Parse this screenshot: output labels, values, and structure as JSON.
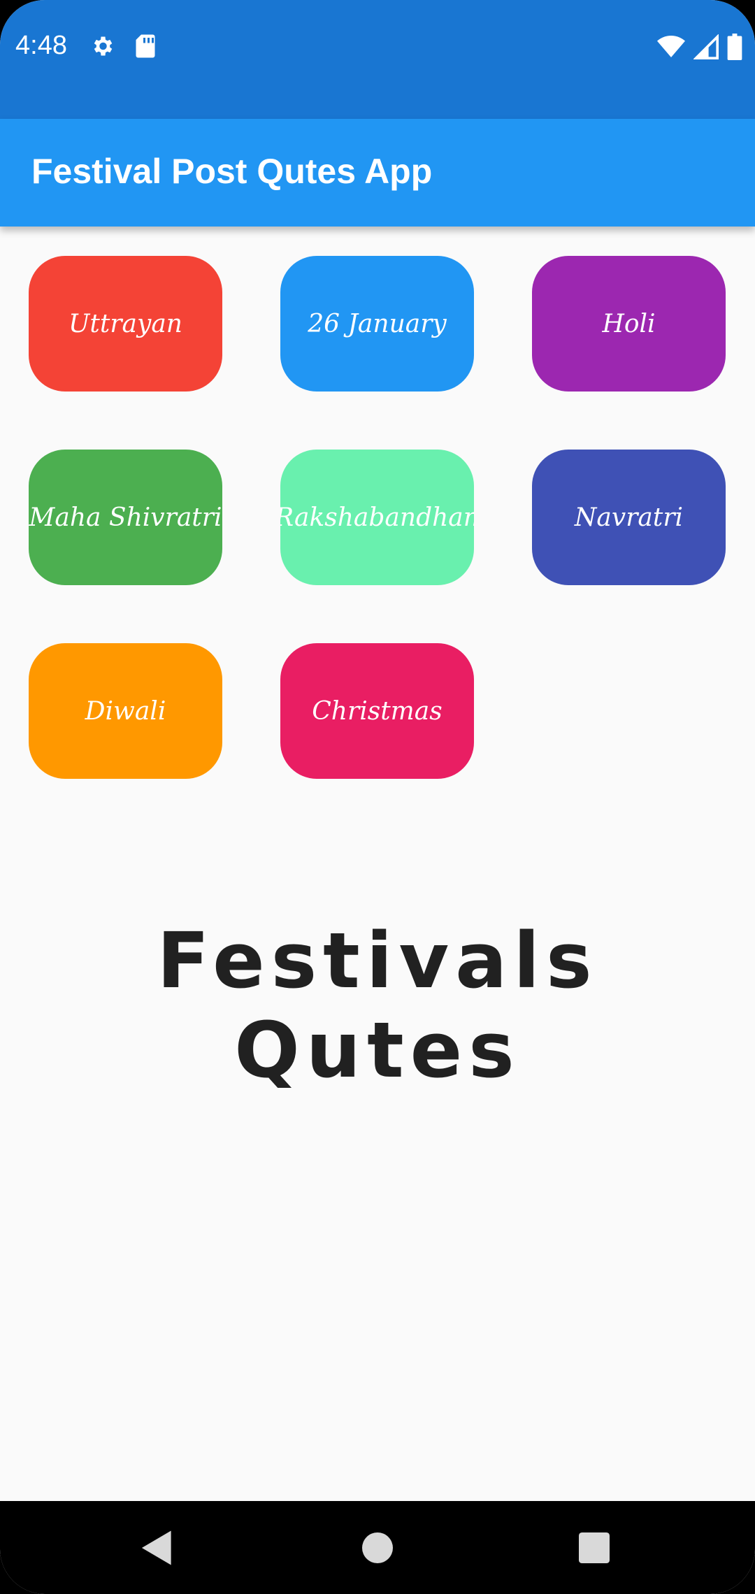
{
  "status_bar": {
    "time": "4:48",
    "left_icons": [
      "gear-icon",
      "sd-card-icon"
    ],
    "right_icons": [
      "wifi-icon",
      "signal-icon",
      "battery-icon"
    ]
  },
  "app_bar": {
    "title": "Festival Post Qutes App"
  },
  "festivals": [
    {
      "label": "Uttrayan",
      "color": "#f44336"
    },
    {
      "label": "26 January",
      "color": "#2196f3"
    },
    {
      "label": "Holi",
      "color": "#9c27b0"
    },
    {
      "label": "Maha Shivratri",
      "color": "#4caf50"
    },
    {
      "label": "Rakshabandhan",
      "color": "#69f0ae"
    },
    {
      "label": "Navratri",
      "color": "#3f51b5"
    },
    {
      "label": "Diwali",
      "color": "#ff9800"
    },
    {
      "label": "Christmas",
      "color": "#e91e63"
    }
  ],
  "headline": "Festivals Qutes",
  "nav_bar": {
    "buttons": [
      "back-icon",
      "home-icon",
      "recents-icon"
    ]
  },
  "colors": {
    "status_bar": "#1976d2",
    "app_bar": "#2196f3",
    "background": "#fafafa"
  }
}
